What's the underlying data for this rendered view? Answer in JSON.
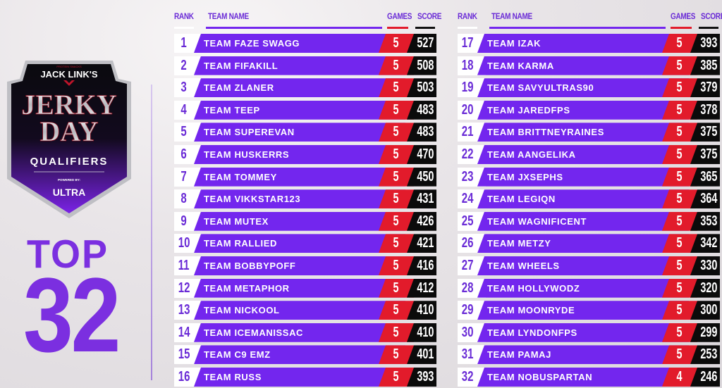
{
  "logo": {
    "tagline": "PROTEIN SNACKS",
    "brand": "JACK LINK'S",
    "title_line1": "JERKY",
    "title_line2": "DAY",
    "subtitle": "QUALIFIERS",
    "powered_by": "POWERED BY:",
    "sponsor": "ULTRA"
  },
  "heading": {
    "top": "TOP",
    "count": "32"
  },
  "headers": {
    "rank": "RANK",
    "team": "TEAM NAME",
    "games": "GAMES",
    "score": "SCORE"
  },
  "colors": {
    "purple": "#7326ee",
    "red": "#e21b2b",
    "black": "#0b0b0b",
    "accent_text": "#7b2fe0"
  },
  "columns": [
    {
      "rows": [
        {
          "rank": "1",
          "team": "TEAM FAZE SWAGG",
          "games": "5",
          "score": "527"
        },
        {
          "rank": "2",
          "team": "TEAM FIFAKILL",
          "games": "5",
          "score": "508"
        },
        {
          "rank": "3",
          "team": "TEAM ZLANER",
          "games": "5",
          "score": "503"
        },
        {
          "rank": "4",
          "team": "TEAM TEEP",
          "games": "5",
          "score": "483"
        },
        {
          "rank": "5",
          "team": "TEAM SUPEREVAN",
          "games": "5",
          "score": "483"
        },
        {
          "rank": "6",
          "team": "TEAM HUSKERRS",
          "games": "5",
          "score": "470"
        },
        {
          "rank": "7",
          "team": "TEAM TOMMEY",
          "games": "5",
          "score": "450"
        },
        {
          "rank": "8",
          "team": "TEAM VIKKSTAR123",
          "games": "5",
          "score": "431"
        },
        {
          "rank": "9",
          "team": "TEAM MUTEX",
          "games": "5",
          "score": "426"
        },
        {
          "rank": "10",
          "team": "TEAM RALLIED",
          "games": "5",
          "score": "421"
        },
        {
          "rank": "11",
          "team": "TEAM BOBBYPOFF",
          "games": "5",
          "score": "416"
        },
        {
          "rank": "12",
          "team": "TEAM METAPHOR",
          "games": "5",
          "score": "412"
        },
        {
          "rank": "13",
          "team": "TEAM NICKOOL",
          "games": "5",
          "score": "410"
        },
        {
          "rank": "14",
          "team": "TEAM ICEMANISSAC",
          "games": "5",
          "score": "410"
        },
        {
          "rank": "15",
          "team": "TEAM C9 EMZ",
          "games": "5",
          "score": "401"
        },
        {
          "rank": "16",
          "team": "TEAM RUSS",
          "games": "5",
          "score": "393"
        }
      ]
    },
    {
      "rows": [
        {
          "rank": "17",
          "team": "TEAM IZAK",
          "games": "5",
          "score": "393"
        },
        {
          "rank": "18",
          "team": "TEAM KARMA",
          "games": "5",
          "score": "385"
        },
        {
          "rank": "19",
          "team": "TEAM SAVYULTRAS90",
          "games": "5",
          "score": "379"
        },
        {
          "rank": "20",
          "team": "TEAM JAREDFPS",
          "games": "5",
          "score": "378"
        },
        {
          "rank": "21",
          "team": "TEAM BRITTNEYRAINES",
          "games": "5",
          "score": "375"
        },
        {
          "rank": "22",
          "team": "TEAM AANGELIKA",
          "games": "5",
          "score": "375"
        },
        {
          "rank": "23",
          "team": "TEAM JXSEPHS",
          "games": "5",
          "score": "365"
        },
        {
          "rank": "24",
          "team": "TEAM LEGIQN",
          "games": "5",
          "score": "364"
        },
        {
          "rank": "25",
          "team": "TEAM WAGNIFICENT",
          "games": "5",
          "score": "353"
        },
        {
          "rank": "26",
          "team": "TEAM METZY",
          "games": "5",
          "score": "342"
        },
        {
          "rank": "27",
          "team": "TEAM WHEELS",
          "games": "5",
          "score": "330"
        },
        {
          "rank": "28",
          "team": "TEAM HOLLYWODZ",
          "games": "5",
          "score": "320"
        },
        {
          "rank": "29",
          "team": "TEAM MOONRYDE",
          "games": "5",
          "score": "300"
        },
        {
          "rank": "30",
          "team": "TEAM LYNDONFPS",
          "games": "5",
          "score": "299"
        },
        {
          "rank": "31",
          "team": "TEAM PAMAJ",
          "games": "5",
          "score": "253"
        },
        {
          "rank": "32",
          "team": "TEAM NOBUSPARTAN",
          "games": "4",
          "score": "246"
        }
      ]
    }
  ]
}
